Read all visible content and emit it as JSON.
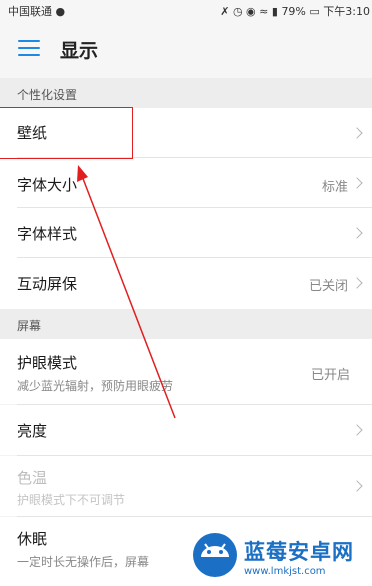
{
  "status_bar": {
    "carrier": "中国联通",
    "battery": "79%",
    "time": "下午3:10"
  },
  "header": {
    "title": "显示"
  },
  "sections": [
    {
      "title": "个性化设置",
      "items": [
        {
          "label": "壁纸",
          "value": ""
        },
        {
          "label": "字体大小",
          "value": "标准"
        },
        {
          "label": "字体样式",
          "value": ""
        },
        {
          "label": "互动屏保",
          "value": "已关闭"
        }
      ]
    },
    {
      "title": "屏幕",
      "items": [
        {
          "label": "护眼模式",
          "subtitle": "减少蓝光辐射，预防用眼疲劳",
          "value": "已开启"
        },
        {
          "label": "亮度",
          "value": ""
        },
        {
          "label": "色温",
          "subtitle": "护眼模式下不可调节",
          "value": "",
          "disabled": true
        },
        {
          "label": "休眠",
          "subtitle": "一定时长无操作后，屏幕",
          "value": ""
        }
      ]
    }
  ],
  "colors": {
    "accent": "#1e88e5",
    "annotation": "#e02020",
    "watermark": "#1b6fc4"
  },
  "watermark": {
    "name": "蓝莓安卓网",
    "url": "www.lmkjst.com"
  }
}
